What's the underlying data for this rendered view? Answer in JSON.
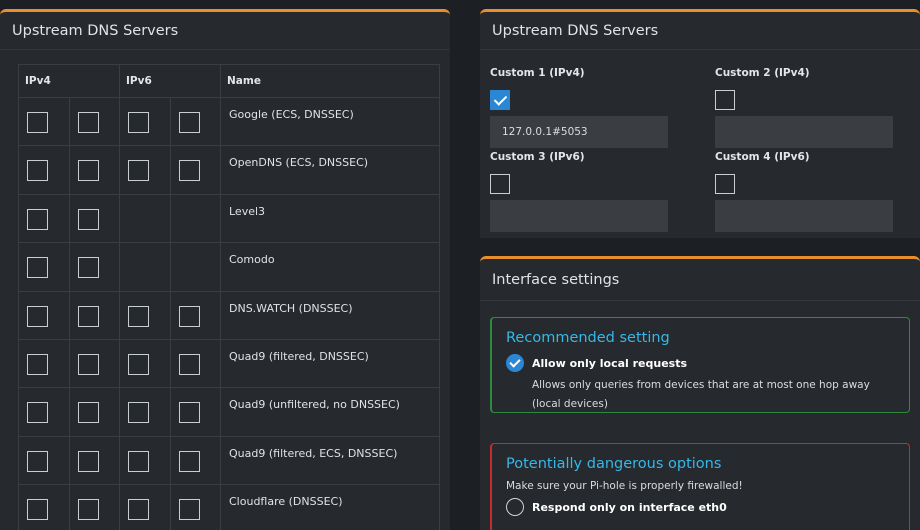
{
  "left_card": {
    "title": "Upstream DNS Servers",
    "headers": {
      "ipv4": "IPv4",
      "ipv6": "IPv6",
      "name": "Name"
    },
    "rows": [
      {
        "name": "Google (ECS, DNSSEC)",
        "ipv6": true
      },
      {
        "name": "OpenDNS (ECS, DNSSEC)",
        "ipv6": true
      },
      {
        "name": "Level3",
        "ipv6": false
      },
      {
        "name": "Comodo",
        "ipv6": false
      },
      {
        "name": "DNS.WATCH (DNSSEC)",
        "ipv6": true
      },
      {
        "name": "Quad9 (filtered, DNSSEC)",
        "ipv6": true
      },
      {
        "name": "Quad9 (unfiltered, no DNSSEC)",
        "ipv6": true
      },
      {
        "name": "Quad9 (filtered, ECS, DNSSEC)",
        "ipv6": true
      },
      {
        "name": "Cloudflare (DNSSEC)",
        "ipv6": true
      }
    ]
  },
  "right_card": {
    "title": "Upstream DNS Servers",
    "custom1": {
      "label": "Custom 1 (IPv4)",
      "checked": true,
      "value": "127.0.0.1#5053"
    },
    "custom2": {
      "label": "Custom 2 (IPv4)",
      "checked": false,
      "value": ""
    },
    "custom3": {
      "label": "Custom 3 (IPv6)",
      "checked": false,
      "value": ""
    },
    "custom4": {
      "label": "Custom 4 (IPv6)",
      "checked": false,
      "value": ""
    }
  },
  "interface_card": {
    "title": "Interface settings",
    "recommended": {
      "title": "Recommended setting",
      "option_label": "Allow only local requests",
      "option_desc": "Allows only queries from devices that are at most one hop away (local devices)"
    },
    "dangerous": {
      "title": "Potentially dangerous options",
      "warning": "Make sure your Pi-hole is properly firewalled!",
      "option_label": "Respond only on interface eth0"
    }
  },
  "colors": {
    "accent_orange": "#e88e2c",
    "check_blue": "#2b87d4",
    "title_cyan": "#36b8e8",
    "ok_green": "#2f8a3e",
    "danger_red": "#c72b2b"
  }
}
